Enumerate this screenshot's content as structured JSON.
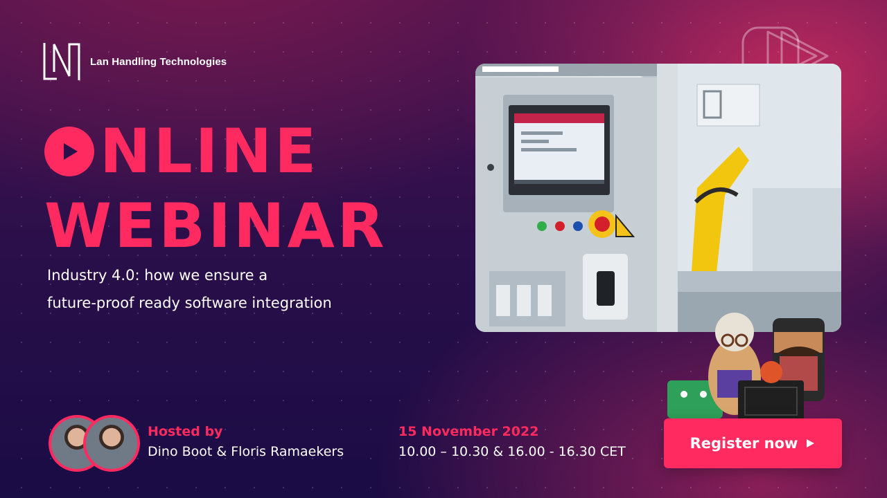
{
  "brand": {
    "name": "Lan Handling Technologies"
  },
  "headline": {
    "line1_rest": "NLINE",
    "line2": "WEBINAR"
  },
  "subtitle": {
    "line1": "Industry 4.0: how we ensure a",
    "line2": "future-proof ready software integration"
  },
  "hosts": {
    "label": "Hosted by",
    "names": "Dino Boot & Floris Ramaekers"
  },
  "event": {
    "date": "15 November 2022",
    "time": "10.00 – 10.30 & 16.00 - 16.30 CET"
  },
  "cta": {
    "label": "Register now"
  },
  "colors": {
    "accent": "#ff2a5f",
    "text": "#ffffff"
  }
}
